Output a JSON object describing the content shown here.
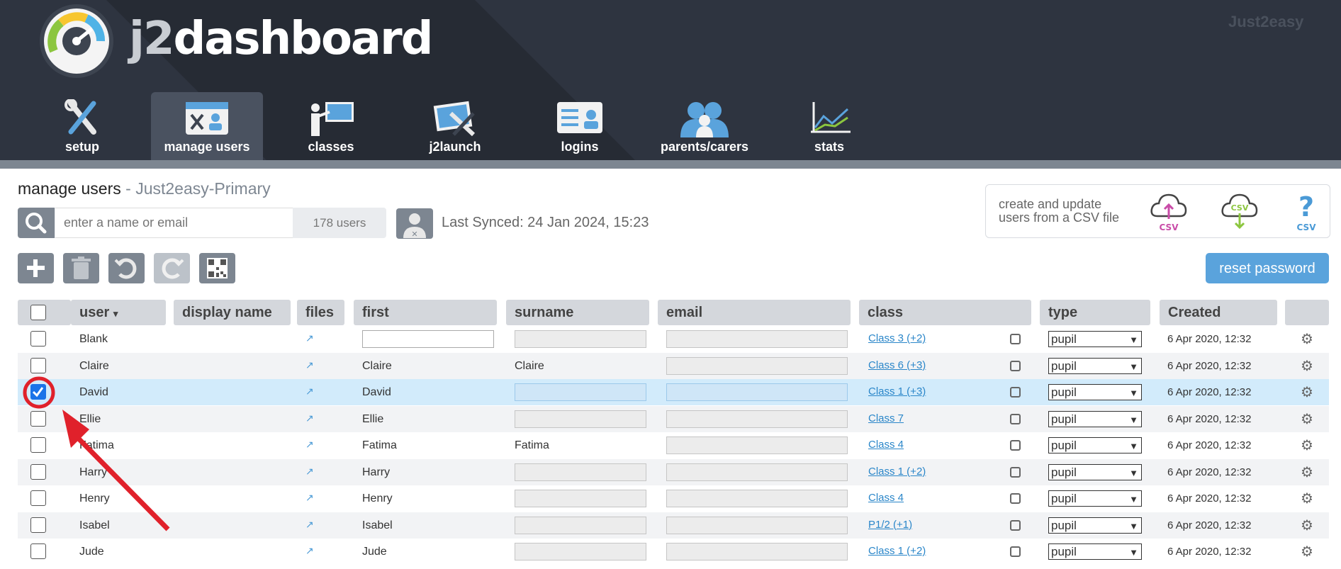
{
  "app": {
    "name": "j2dashboard",
    "name_j2": "j2",
    "name_rest": "dashboard",
    "brand": "Just2easy"
  },
  "nav": [
    {
      "label": "setup"
    },
    {
      "label": "manage users"
    },
    {
      "label": "classes"
    },
    {
      "label": "j2launch"
    },
    {
      "label": "logins"
    },
    {
      "label": "parents/carers"
    },
    {
      "label": "stats"
    }
  ],
  "page": {
    "title": "manage users",
    "separator": " - ",
    "school": "Just2easy-Primary"
  },
  "search": {
    "placeholder": "enter a name or email",
    "count": "178 users"
  },
  "sync": {
    "text": "Last Synced: 24 Jan 2024, 15:23"
  },
  "csv": {
    "line1": "create and update",
    "line2": "users from a CSV file",
    "icon_label": "CSV"
  },
  "toolbar": {
    "reset_label": "reset password"
  },
  "table": {
    "headers": {
      "user": "user",
      "user_sort": "▾",
      "display": "display name",
      "files": "files",
      "first": "first",
      "surname": "surname",
      "email": "email",
      "class": "class",
      "type": "type",
      "created": "Created"
    },
    "rows": [
      {
        "user": "Blank",
        "first": "",
        "surname": "",
        "class": "Class 3 (+2)",
        "type": "pupil",
        "created": "6 Apr 2020, 12:32",
        "checked": false
      },
      {
        "user": "Claire",
        "first": "Claire",
        "surname": "Claire",
        "class": "Class 6 (+3)",
        "type": "pupil",
        "created": "6 Apr 2020, 12:32",
        "checked": false
      },
      {
        "user": "David",
        "first": "David",
        "surname": "",
        "class": "Class 1 (+3)",
        "type": "pupil",
        "created": "6 Apr 2020, 12:32",
        "checked": true
      },
      {
        "user": "Ellie",
        "first": "Ellie",
        "surname": "",
        "class": "Class 7",
        "type": "pupil",
        "created": "6 Apr 2020, 12:32",
        "checked": false
      },
      {
        "user": "Fatima",
        "first": "Fatima",
        "surname": "Fatima",
        "class": "Class 4",
        "type": "pupil",
        "created": "6 Apr 2020, 12:32",
        "checked": false
      },
      {
        "user": "Harry",
        "first": "Harry",
        "surname": "",
        "class": "Class 1 (+2)",
        "type": "pupil",
        "created": "6 Apr 2020, 12:32",
        "checked": false
      },
      {
        "user": "Henry",
        "first": "Henry",
        "surname": "",
        "class": "Class 4",
        "type": "pupil",
        "created": "6 Apr 2020, 12:32",
        "checked": false
      },
      {
        "user": "Isabel",
        "first": "Isabel",
        "surname": "",
        "class": "P1/2 (+1)",
        "type": "pupil",
        "created": "6 Apr 2020, 12:32",
        "checked": false
      },
      {
        "user": "Jude",
        "first": "Jude",
        "surname": "",
        "class": "Class 1 (+2)",
        "type": "pupil",
        "created": "6 Apr 2020, 12:32",
        "checked": false
      }
    ]
  },
  "colors": {
    "header": "#2e3440",
    "accent": "#5aa3dc",
    "annotation": "#e0212b"
  }
}
